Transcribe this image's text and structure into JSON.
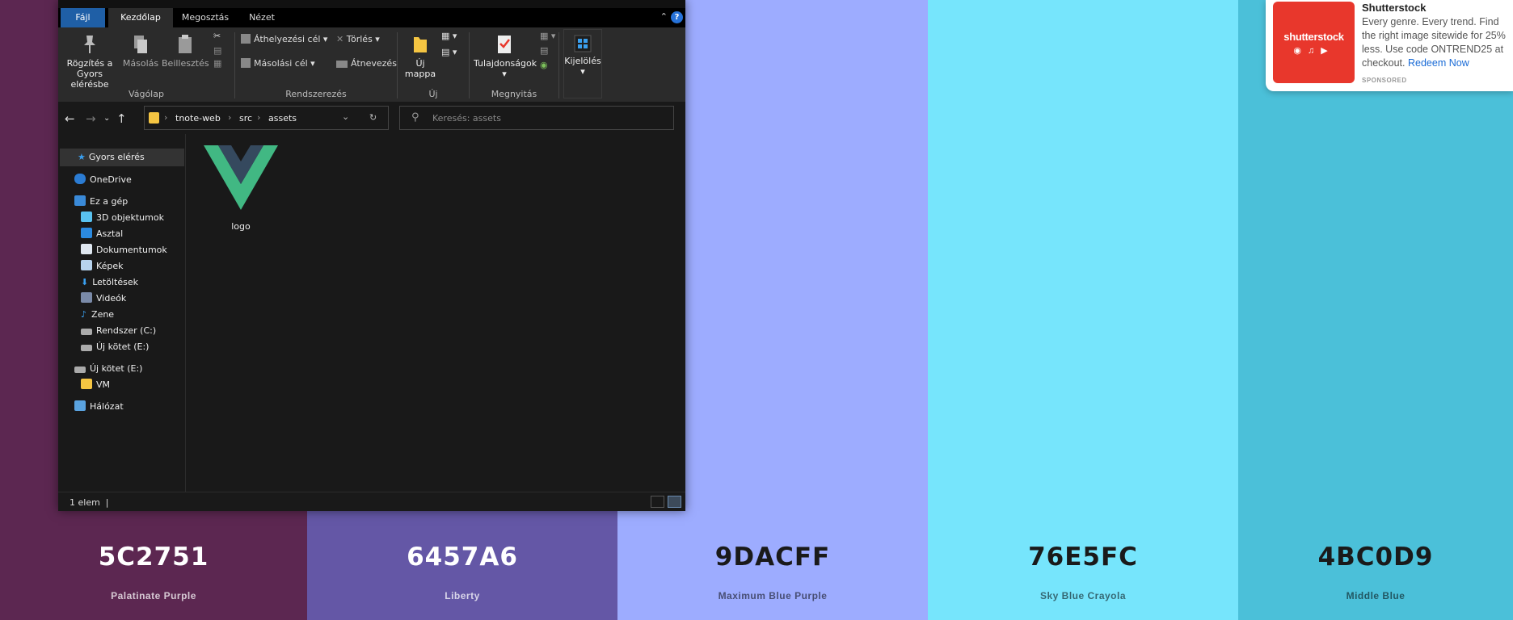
{
  "palette": [
    {
      "hex": "5C2751",
      "name": "Palatinate Purple",
      "color": "#5C2751",
      "text": "light"
    },
    {
      "hex": "6457A6",
      "name": "Liberty",
      "color": "#6457A6",
      "text": "light"
    },
    {
      "hex": "9DACFF",
      "name": "Maximum Blue Purple",
      "color": "#9DACFF",
      "text": "dark"
    },
    {
      "hex": "76E5FC",
      "name": "Sky Blue Crayola",
      "color": "#76E5FC",
      "text": "dark"
    },
    {
      "hex": "4BC0D9",
      "name": "Middle Blue",
      "color": "#4BC0D9",
      "text": "dark"
    }
  ],
  "ad": {
    "logo_text": "shutterstock",
    "title": "Shutterstock",
    "body": "Every genre. Every trend. Find the right image sitewide for 25% less. Use code ONTREND25 at checkout.",
    "link": "Redeem Now",
    "sponsored": "SPONSORED"
  },
  "explorer": {
    "tabs": {
      "file": "Fájl",
      "home": "Kezdőlap",
      "share": "Megosztás",
      "view": "Nézet",
      "help": "?"
    },
    "ribbon": {
      "pin": "Rögzítés a Gyors elérésbe",
      "copy": "Másolás",
      "paste": "Beillesztés",
      "move_to": "Áthelyezési cél",
      "copy_to": "Másolási cél",
      "delete": "Törlés",
      "rename": "Átnevezés",
      "new_folder": "Új mappa",
      "properties": "Tulajdonságok",
      "select": "Kijelölés",
      "groups": {
        "clipboard": "Vágólap",
        "organize": "Rendszerezés",
        "new": "Új",
        "open": "Megnyitás"
      }
    },
    "address": {
      "crumbs": [
        "tnote-web",
        "src",
        "assets"
      ],
      "search_placeholder": "Keresés: assets"
    },
    "sidebar": {
      "quick_access": "Gyors elérés",
      "onedrive": "OneDrive",
      "this_pc": "Ez a gép",
      "objects3d": "3D objektumok",
      "desktop": "Asztal",
      "documents": "Dokumentumok",
      "pictures": "Képek",
      "downloads": "Letöltések",
      "videos": "Videók",
      "music": "Zene",
      "system_c": "Rendszer (C:)",
      "volume_e": "Új kötet (E:)",
      "volume_e2": "Új kötet (E:)",
      "vm": "VM",
      "network": "Hálózat"
    },
    "files": [
      {
        "name": "logo"
      }
    ],
    "status": {
      "count": "1 elem"
    }
  }
}
